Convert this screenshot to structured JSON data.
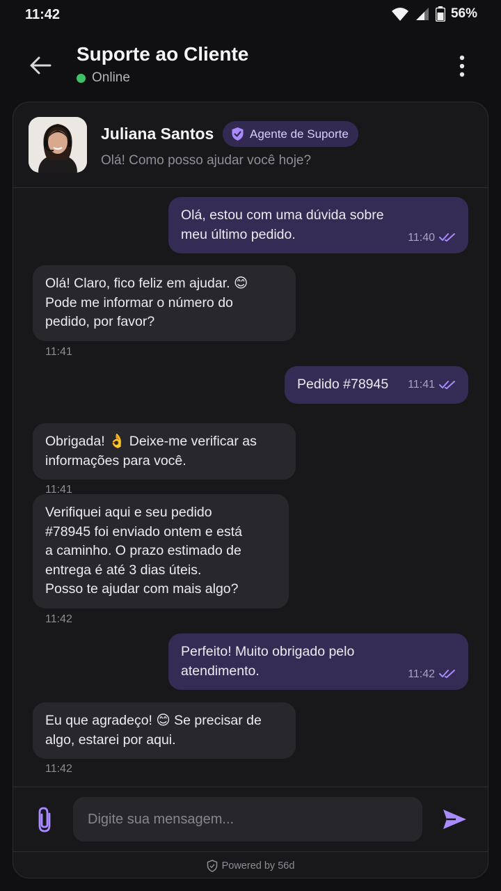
{
  "status_bar": {
    "time": "11:42",
    "battery": "56%"
  },
  "header": {
    "title": "Suporte ao Cliente",
    "status": "Online"
  },
  "agent": {
    "name": "Juliana Santos",
    "badge": "Agente de Suporte",
    "greeting": "Olá! Como posso ajudar você hoje?"
  },
  "messages": [
    {
      "from": "user",
      "line1": "Olá, estou com uma dúvida sobre",
      "line2": "meu último pedido.",
      "time": "11:40"
    },
    {
      "from": "agent",
      "line1": "Olá! Claro, fico feliz em ajudar. 😊",
      "line2": "Pode me informar o número do",
      "line3": "pedido, por favor?",
      "time": "11:41"
    },
    {
      "from": "user",
      "line1": "Pedido #78945",
      "time": "11:41"
    },
    {
      "from": "agent",
      "line1": "Obrigada! 👌 Deixe-me verificar as",
      "line2": "informações para você.",
      "time": "11:41"
    },
    {
      "from": "agent",
      "line1": "Verifiquei aqui e seu pedido",
      "line2": "#78945 foi enviado ontem e está",
      "line3": "a caminho. O prazo estimado de",
      "line4": "entrega é até 3 dias úteis.",
      "line5": "Posso te ajudar com mais algo?",
      "time": "11:42"
    },
    {
      "from": "user",
      "line1": "Perfeito! Muito obrigado pelo",
      "line2": "atendimento.",
      "time": "11:42"
    },
    {
      "from": "agent",
      "line1": "Eu que agradeço! 😊 Se precisar de",
      "line2": "algo, estarei por aqui.",
      "time": "11:42"
    }
  ],
  "composer": {
    "placeholder": "Digite sua mensagem..."
  },
  "footer": {
    "powered": "Powered by 56d"
  },
  "colors": {
    "accent": "#a98bff",
    "online": "#3fc267",
    "outgoing_bubble": "#342c54",
    "incoming_bubble": "#28282c"
  },
  "icons": [
    "wifi-icon",
    "signal-icon",
    "battery-icon",
    "back-arrow-icon",
    "more-vert-icon",
    "verified-shield-icon",
    "double-check-icon",
    "paperclip-icon",
    "send-icon",
    "shield-icon"
  ]
}
